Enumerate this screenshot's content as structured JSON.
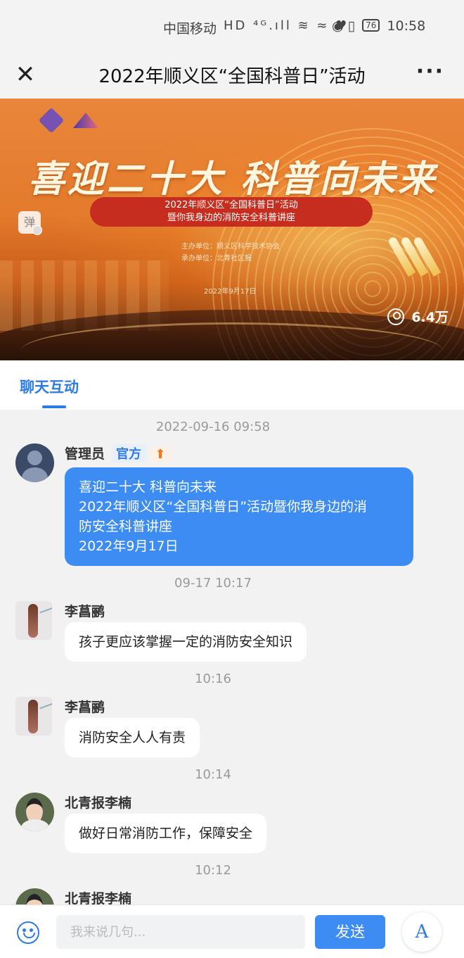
{
  "status_bar": {
    "carrier": "中国移动",
    "network_icons": "HD ⁴ᴳ.ıll ≋ ≈ ♥",
    "eye_vibrate": "◉ ▯",
    "battery": "76",
    "time": "10:58"
  },
  "nav": {
    "title": "2022年顺义区“全国科普日”活动",
    "close_icon": "close-icon",
    "more_icon": "more-icon"
  },
  "banner": {
    "headline": "喜迎二十大 科普向未来",
    "subtitle_line1": "2022年顺义区“全国科普日”活动",
    "subtitle_line2": "暨你我身边的消防安全科普讲座",
    "organizer": "主办单位：顺义区科学技术协会",
    "co_organizer": "承办单位：北青社区报",
    "date": "2022年9月17日",
    "danmu_label": "弹",
    "viewers": "6.4万"
  },
  "tabs": {
    "active": "聊天互动"
  },
  "chat": {
    "messages": [
      {
        "timestamp": "2022-09-16 09:58",
        "user": "管理员",
        "badge": "官方",
        "pin": "⬆",
        "lines": [
          "喜迎二十大 科普向未来",
          "2022年顺义区“全国科普日”活动暨你我身边的消",
          "防安全科普讲座",
          "2022年9月17日"
        ]
      },
      {
        "timestamp": "09-17 10:17",
        "user": "李菖鹂",
        "text": "孩子更应该掌握一定的消防安全知识"
      },
      {
        "timestamp": "10:16",
        "user": "李菖鹂",
        "text": "消防安全人人有责"
      },
      {
        "timestamp": "10:14",
        "user": "北青报李楠",
        "text": "做好日常消防工作，保障安全"
      },
      {
        "timestamp": "10:12",
        "user": "北青报李楠"
      }
    ]
  },
  "input": {
    "placeholder": "我来说几句...",
    "send_label": "发送",
    "font_button": "A"
  },
  "colors": {
    "accent": "#2f7be6",
    "bubble_blue": "#3c8cf4",
    "pin_orange": "#f07a1a",
    "banner_red": "#c62d1e"
  }
}
